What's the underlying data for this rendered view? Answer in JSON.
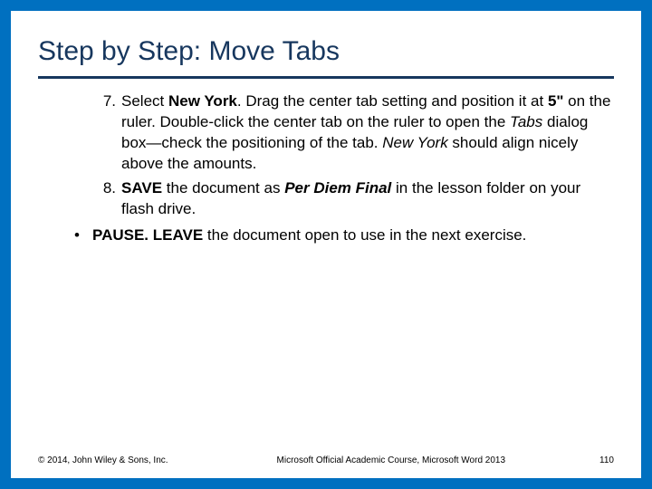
{
  "title": "Step by Step: Move Tabs",
  "steps": [
    {
      "num": "7.",
      "segments": [
        {
          "t": "Select "
        },
        {
          "t": "New York",
          "b": true
        },
        {
          "t": ". Drag the center tab setting and position it at "
        },
        {
          "t": "5\"",
          "b": true
        },
        {
          "t": " on the ruler. Double-click the center tab on the ruler to open the "
        },
        {
          "t": "Tabs",
          "i": true
        },
        {
          "t": " dialog box—check the positioning of the tab. "
        },
        {
          "t": "New York",
          "i": true
        },
        {
          "t": " should align nicely above the amounts."
        }
      ]
    },
    {
      "num": "8.",
      "segments": [
        {
          "t": " "
        },
        {
          "t": "SAVE",
          "b": true
        },
        {
          "t": " the document as "
        },
        {
          "t": "Per Diem Final",
          "b": true,
          "i": true
        },
        {
          "t": " in the lesson folder on your flash drive."
        }
      ]
    }
  ],
  "bullets": [
    {
      "segments": [
        {
          "t": "PAUSE. LEAVE",
          "b": true
        },
        {
          "t": " the document open to use in the next exercise."
        }
      ]
    }
  ],
  "footer": {
    "left": "© 2014, John Wiley & Sons, Inc.",
    "center": "Microsoft Official Academic Course, Microsoft Word 2013",
    "page": "110"
  }
}
